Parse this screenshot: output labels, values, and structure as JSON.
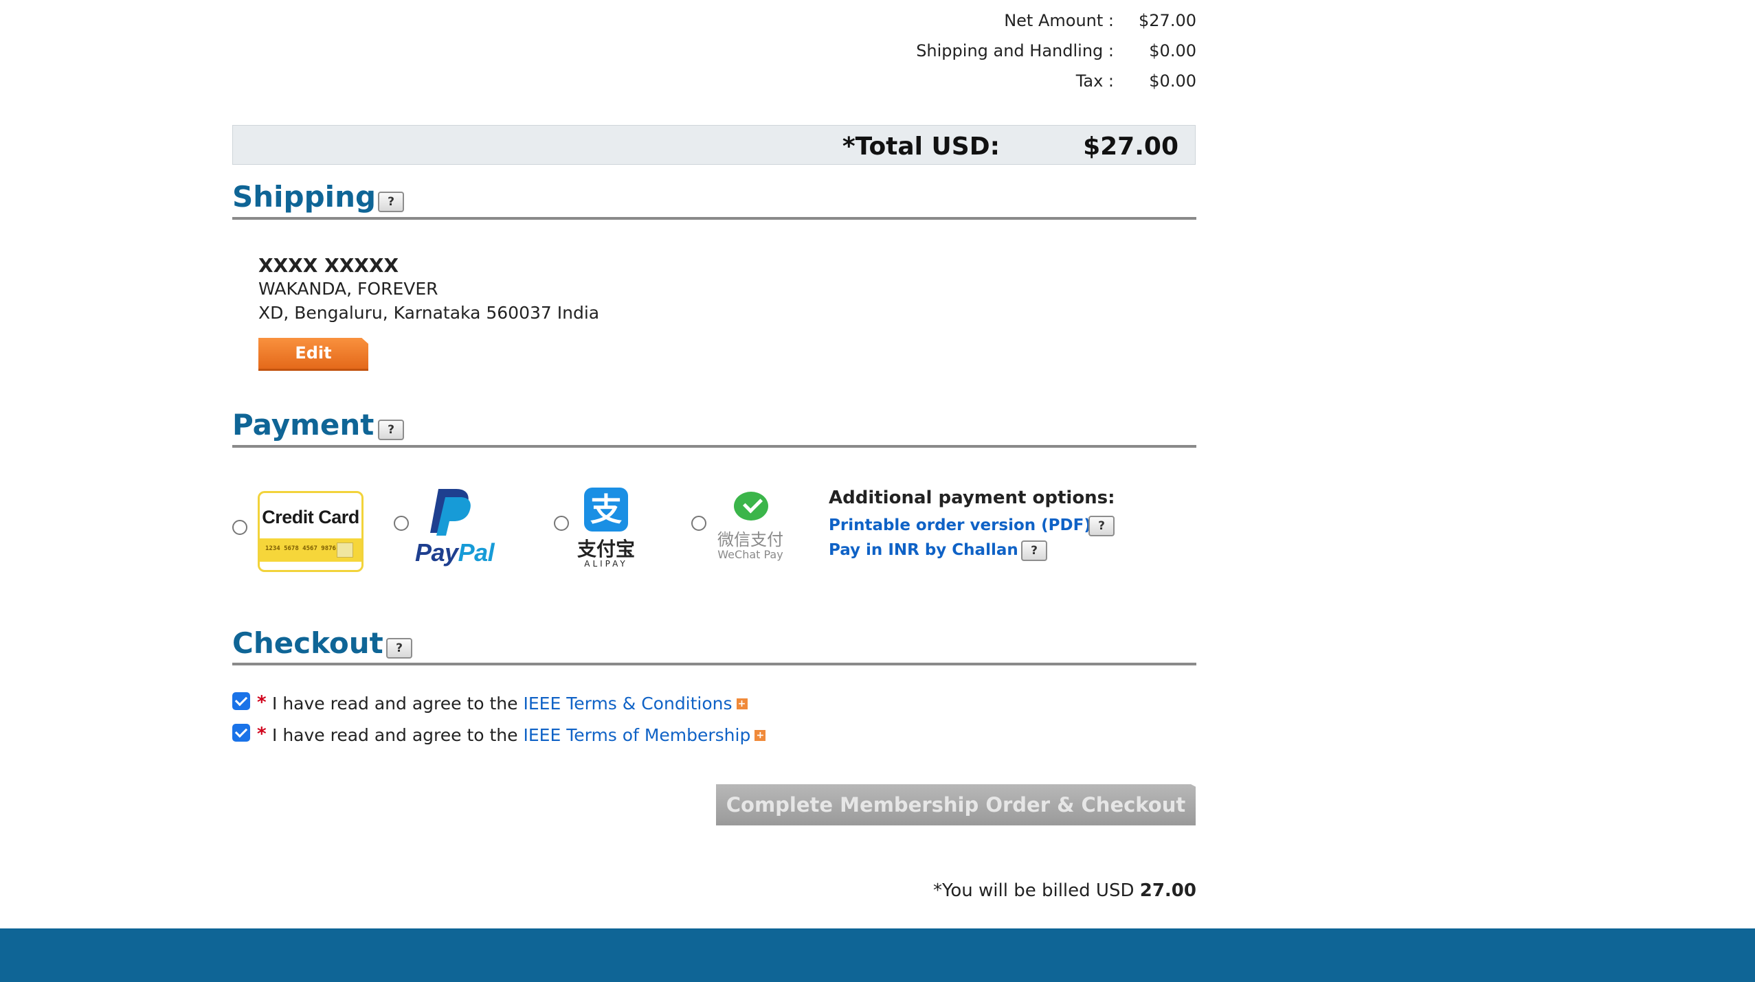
{
  "summary": {
    "net_amount_label": "Net Amount :",
    "net_amount_value": "$27.00",
    "shipping_label": "Shipping and Handling :",
    "shipping_value": "$0.00",
    "tax_label": "Tax :",
    "tax_value": "$0.00",
    "total_label": "*Total USD:",
    "total_value": "$27.00"
  },
  "shipping": {
    "title": "Shipping",
    "help": "?",
    "name": "XXXX XXXXX",
    "address_line1": "WAKANDA, FOREVER",
    "address_line2": "XD,  Bengaluru, Karnataka 560037 India",
    "edit_label": "Edit"
  },
  "payment": {
    "title": "Payment",
    "help": "?",
    "options": {
      "credit_card": {
        "title": "Credit Card",
        "number": "1234 5678 4567 9876"
      },
      "paypal": {
        "text_pay": "Pay",
        "text_pal": "Pal"
      },
      "alipay": {
        "mark": "支",
        "cn": "支付宝",
        "en": "ALIPAY"
      },
      "wechat": {
        "cn": "微信支付",
        "en": "WeChat Pay"
      }
    },
    "additional_title": "Additional payment options:",
    "pdf_link": "Printable order version (PDF)",
    "challan_link": "Pay in INR by Challan",
    "help_pdf": "?",
    "help_challan": "?"
  },
  "checkout": {
    "title": "Checkout",
    "help": "?",
    "required_mark": "*",
    "agree_prefix": "I have read and agree to the",
    "terms_conditions_link": "IEEE Terms & Conditions",
    "terms_membership_link": "IEEE Terms of Membership",
    "external_marker": "+",
    "button_label": "Complete Membership Order & Checkout",
    "billed_prefix": "*You will be billed USD",
    "billed_amount": "27.00"
  },
  "colors": {
    "section_title": "#0f6596",
    "link": "#0f62c6",
    "footer": "#0f6596",
    "edit_button": "#f08a3a"
  }
}
